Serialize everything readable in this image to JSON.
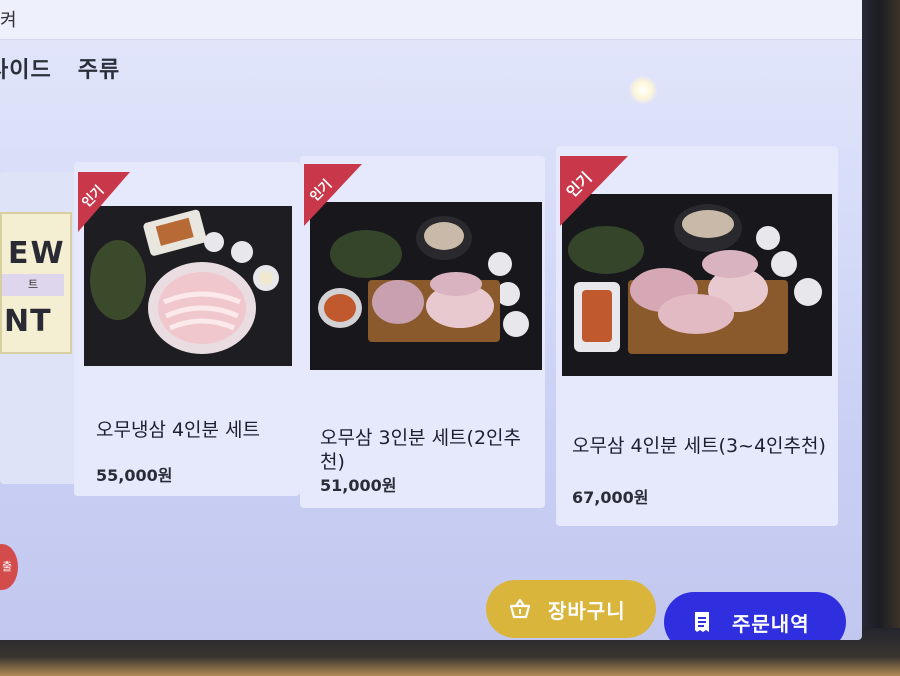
{
  "header": {
    "glyph": "켜"
  },
  "category_tabs": [
    {
      "label": "사이드"
    },
    {
      "label": "주류"
    }
  ],
  "new_badge": {
    "line1": "EW",
    "line2": "트",
    "line3": "NT"
  },
  "menu_items": [
    {
      "name": "오무냉삼 4인분 세트",
      "price": "55,000원",
      "ribbon": "인기"
    },
    {
      "name": "오무삼 3인분 세트(2인추천)",
      "price": "51,000원",
      "ribbon": "인기"
    },
    {
      "name": "오무삼 4인분 세트(3~4인추천)",
      "price": "67,000원",
      "ribbon": "인기"
    }
  ],
  "side_dot": {
    "label": "출"
  },
  "buttons": {
    "cart_label": "장바구니",
    "orders_label": "주문내역"
  },
  "colors": {
    "ribbon": "#c8384a",
    "cart_button": "#d9b53c",
    "orders_button": "#2f2fe0"
  }
}
